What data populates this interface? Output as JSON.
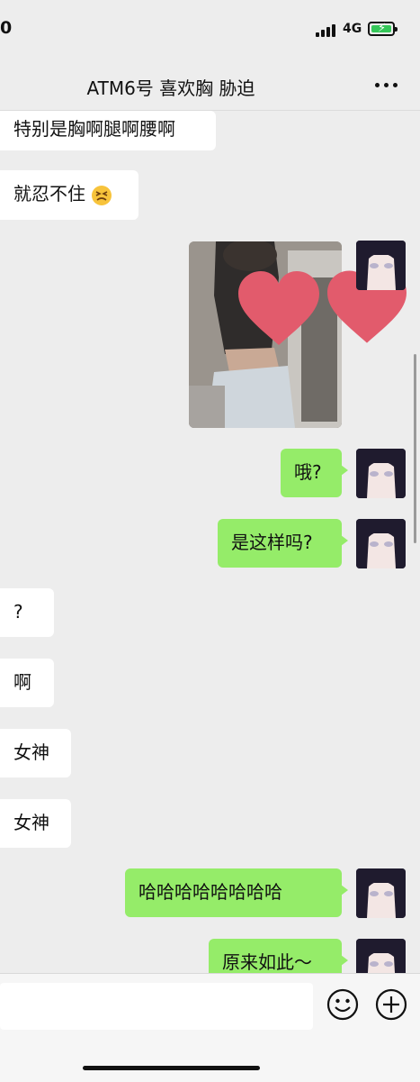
{
  "status_bar": {
    "time": "0",
    "network": "4G"
  },
  "header": {
    "title": "ATM6号 喜欢胸 胁迫",
    "more_icon": "more-dots-icon"
  },
  "messages": [
    {
      "side": "in",
      "text": "特别是胸啊腿啊腰啊"
    },
    {
      "side": "in",
      "text": "就忍不住",
      "emoji": "persevering-face-emoji"
    },
    {
      "side": "out",
      "type": "image",
      "image": "photo-message"
    },
    {
      "side": "out",
      "text": "哦?"
    },
    {
      "side": "out",
      "text": "是这样吗?"
    },
    {
      "side": "in",
      "text": "?"
    },
    {
      "side": "in",
      "text": "啊"
    },
    {
      "side": "in",
      "text": "女神"
    },
    {
      "side": "in",
      "text": "女神"
    },
    {
      "side": "out",
      "text": "哈哈哈哈哈哈哈哈"
    },
    {
      "side": "out",
      "text": "原来如此～"
    }
  ],
  "input_bar": {
    "placeholder": "",
    "emoji_icon": "emoji-face-icon",
    "plus_icon": "plus-circle-icon"
  },
  "colors": {
    "background": "#ededed",
    "outgoing_bubble": "#95ec69",
    "incoming_bubble": "#ffffff",
    "heart": "#e25b6c"
  }
}
